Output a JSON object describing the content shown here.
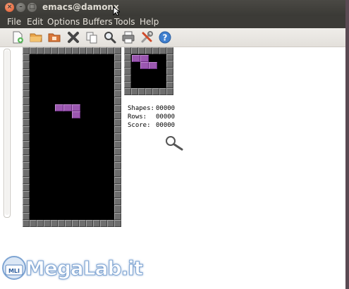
{
  "window": {
    "title": "emacs@damonx"
  },
  "menubar": {
    "items": [
      "File",
      "Edit",
      "Options",
      "Buffers",
      "Tools",
      "Help"
    ]
  },
  "toolbar": {
    "buttons": [
      {
        "icon": "new-file-icon"
      },
      {
        "icon": "open-folder-icon"
      },
      {
        "icon": "open-directory-icon"
      },
      {
        "icon": "close-icon"
      },
      {
        "icon": "copy-icon"
      },
      {
        "icon": "search-icon"
      },
      {
        "icon": "print-icon"
      },
      {
        "icon": "preferences-icon"
      },
      {
        "icon": "help-icon"
      }
    ]
  },
  "game": {
    "name": "Tetris",
    "stats": [
      {
        "label": "Shapes:",
        "value": "00000"
      },
      {
        "label": "Rows:",
        "value": "00000"
      },
      {
        "label": "Score:",
        "value": "00000"
      }
    ],
    "piece_color": "#9b57b0",
    "border_color": "#6e6e6e",
    "well_color": "#000000"
  },
  "watermark": {
    "text": "MegaLab.it",
    "badge": "MLI"
  }
}
